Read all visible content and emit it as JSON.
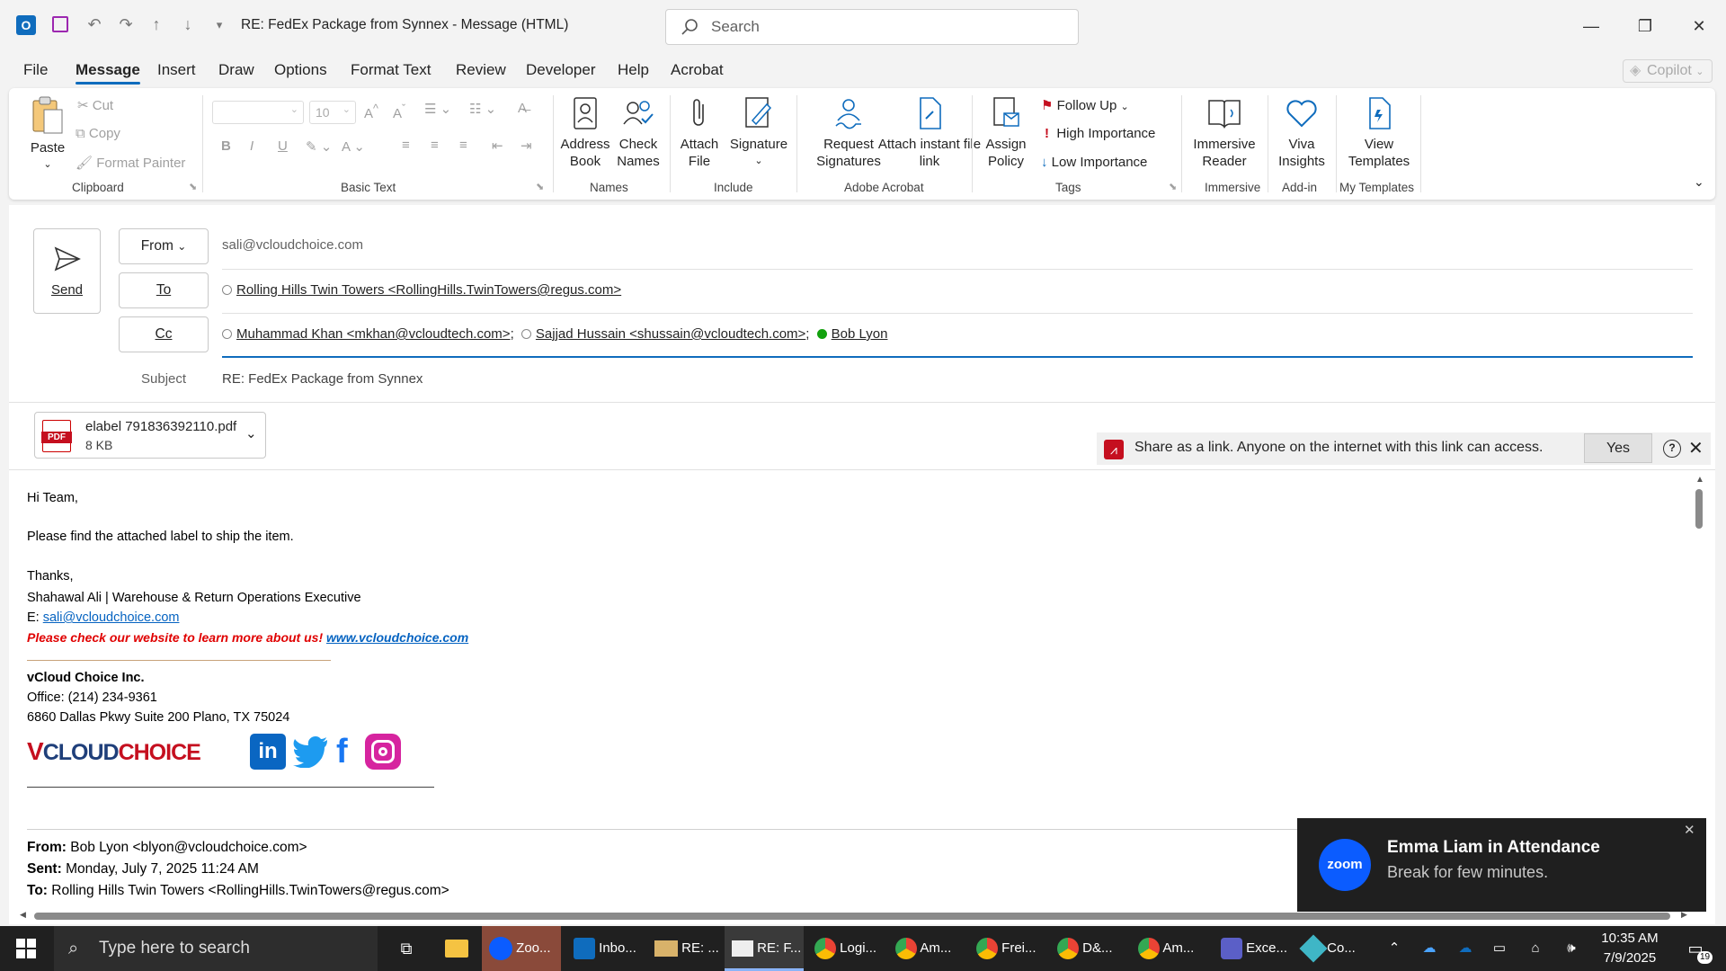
{
  "window": {
    "title": "RE: FedEx Package from Synnex  -  Message (HTML)",
    "search_placeholder": "Search"
  },
  "menu": {
    "items": [
      "File",
      "Message",
      "Insert",
      "Draw",
      "Options",
      "Format Text",
      "Review",
      "Developer",
      "Help",
      "Acrobat"
    ],
    "active": "Message",
    "copilot": "Copilot"
  },
  "ribbon": {
    "clipboard": {
      "paste": "Paste",
      "cut": "Cut",
      "copy": "Copy",
      "format_painter": "Format Painter",
      "label": "Clipboard"
    },
    "basic_text": {
      "font_size": "10",
      "label": "Basic Text"
    },
    "names": {
      "address_book": "Address Book",
      "check_names": "Check Names",
      "label": "Names"
    },
    "include": {
      "attach_file": "Attach File",
      "signature": "Signature",
      "label": "Include"
    },
    "acrobat": {
      "request_signatures": "Request Signatures",
      "attach_link": "Attach instant file link",
      "label": "Adobe Acrobat"
    },
    "tags": {
      "assign_policy": "Assign Policy",
      "follow_up": "Follow Up",
      "high_importance": "High Importance",
      "low_importance": "Low Importance",
      "label": "Tags"
    },
    "immersive": {
      "immersive_reader": "Immersive Reader",
      "label": "Immersive"
    },
    "addin": {
      "viva_insights": "Viva Insights",
      "label": "Add-in"
    },
    "templates": {
      "view_templates": "View Templates",
      "label": "My Templates"
    }
  },
  "compose": {
    "send": "Send",
    "from_label": "From",
    "from_value": "sali@vcloudchoice.com",
    "to_label": "To",
    "to": [
      {
        "text": "Rolling Hills Twin Towers <RollingHills.TwinTowers@regus.com>",
        "online": false
      }
    ],
    "cc_label": "Cc",
    "cc": [
      {
        "text": "Muhammad Khan <mkhan@vcloudtech.com>",
        "sep": ";",
        "online": false
      },
      {
        "text": "Sajjad Hussain <shussain@vcloudtech.com>",
        "sep": ";",
        "online": false
      },
      {
        "text": "Bob Lyon",
        "sep": "",
        "online": true
      }
    ],
    "subject_label": "Subject",
    "subject_value": "RE: FedEx Package from Synnex"
  },
  "attachment": {
    "name": "elabel 791836392110.pdf",
    "size": "8 KB",
    "icon": "pdf-icon"
  },
  "share_bar": {
    "text": "Share as a link. Anyone on the internet with this link can access.",
    "yes": "Yes"
  },
  "body": {
    "greeting": "Hi Team,",
    "line1": "Please find the attached label to ship the item.",
    "thanks": "Thanks,",
    "name_title": "Shahawal Ali | Warehouse & Return Operations Executive",
    "email_prefix": "E: ",
    "email": "sali@vcloudchoice.com",
    "promo": "Please check our website to learn more about us! ",
    "website": "www.vcloudchoice.com",
    "company": "vCloud Choice Inc.",
    "office": "Office: (214) 234-9361",
    "address": "6860 Dallas Pkwy Suite 200 Plano, TX 75024",
    "logo_text": "VCLOUDCHOICE",
    "quoted": {
      "from_label": "From:",
      "from": "Bob Lyon <blyon@vcloudchoice.com>",
      "sent_label": "Sent:",
      "sent": "Monday, July 7, 2025 11:24 AM",
      "to_label": "To:",
      "to": "Rolling Hills Twin Towers <RollingHills.TwinTowers@regus.com>"
    }
  },
  "toast": {
    "title": "Emma Liam in Attendance",
    "message": "Break for few minutes.",
    "app": "zoom"
  },
  "taskbar": {
    "search_placeholder": "Type here to search",
    "apps": [
      "Zoo...",
      "Inbo...",
      "RE: ...",
      "RE: F...",
      "Logi...",
      "Am...",
      "Frei...",
      "D&...",
      "Am...",
      "Exce...",
      "Co..."
    ],
    "time": "10:35 AM",
    "date": "7/9/2025",
    "notifications": "19"
  },
  "colors": {
    "accent": "#0f6cbd",
    "link": "#0563c1",
    "promo_red": "#e00000",
    "taskbar": "#202020"
  }
}
